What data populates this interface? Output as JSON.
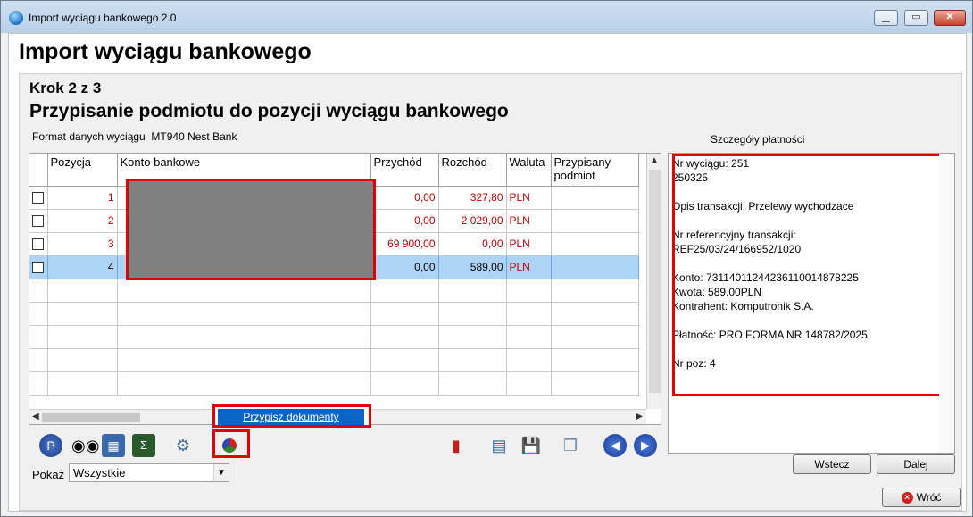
{
  "window": {
    "title": "Import wyciągu bankowego 2.0",
    "minimize": "▁",
    "maximize": "▭",
    "close": "✕"
  },
  "header": {
    "main_title": "Import wyciągu bankowego"
  },
  "step": {
    "label": "Krok 2 z 3",
    "subtitle": "Przypisanie podmiotu do pozycji wyciągu bankowego"
  },
  "format": {
    "label": "Format danych wyciągu",
    "value": "MT940 Nest Bank"
  },
  "grid": {
    "columns": [
      "Pozycja",
      "Konto bankowe",
      "Przychód",
      "Rozchód",
      "Waluta",
      "Przypisany podmiot"
    ],
    "rows": [
      {
        "pozycja": "1",
        "konto": "",
        "przychod": "0,00",
        "rozchod": "327,80",
        "waluta": "PLN",
        "podmiot": ""
      },
      {
        "pozycja": "2",
        "konto": "",
        "przychod": "0,00",
        "rozchod": "2 029,00",
        "waluta": "PLN",
        "podmiot": ""
      },
      {
        "pozycja": "3",
        "konto": "",
        "przychod": "69 900,00",
        "rozchod": "0,00",
        "waluta": "PLN",
        "podmiot": ""
      },
      {
        "pozycja": "4",
        "konto": "",
        "przychod": "0,00",
        "rozchod": "589,00",
        "waluta": "PLN",
        "podmiot": "",
        "selected": true
      }
    ]
  },
  "context_menu": {
    "item": "Przypisz dokumenty"
  },
  "toolbar_icons": [
    "search-icon",
    "binoculars-icon",
    "calendar-table-icon",
    "formula-icon",
    "settings-gears-icon",
    "assign-documents-icon",
    "report-icon",
    "document-list-icon",
    "save-icon",
    "copy-windows-icon",
    "first-record-icon",
    "last-record-icon"
  ],
  "filter": {
    "label": "Pokaż",
    "value": "Wszystkie"
  },
  "details": {
    "label": "Szczegóły płatności",
    "text": "Nr wyciągu: 251\n250325\n\nOpis transakcji: Przelewy wychodzace\n\nNr referencyjny transakcji:\nREF25/03/24/166952/1020\n\nKonto: 73114011244236110014878225\nKwota: 589.00PLN\nKontrahent: Komputronik S.A.\n\nPłatność: PRO FORMA NR 148782/2025\n\nNr poz: 4"
  },
  "buttons": {
    "back": "Wstecz",
    "next": "Dalej",
    "return": "Wróć"
  },
  "colors": {
    "accent": "#0a64c8",
    "highlight_red": "#e00000",
    "row_selected": "#aed4f5",
    "amount_red": "#c00000"
  }
}
